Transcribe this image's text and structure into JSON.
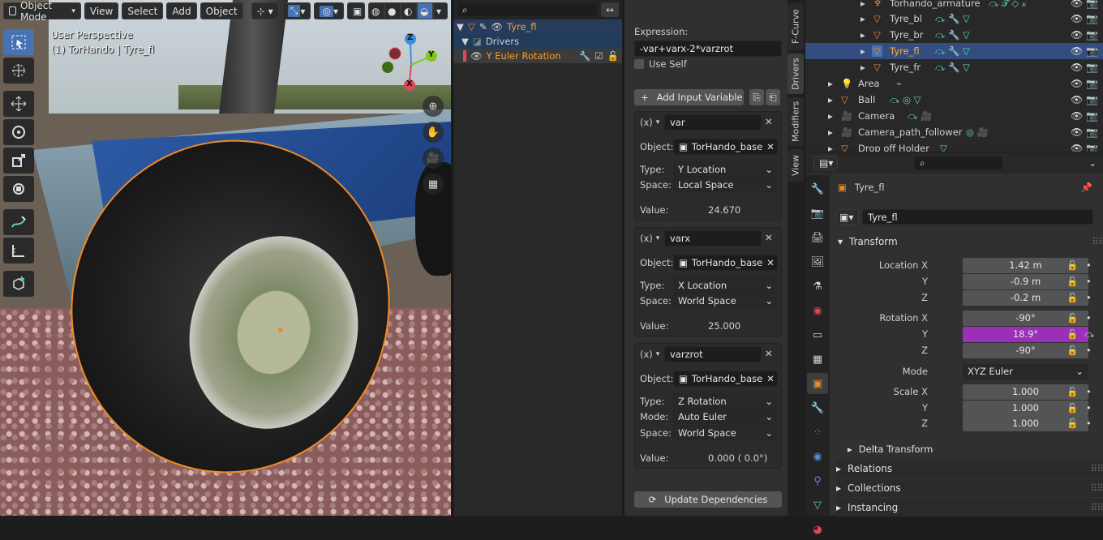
{
  "viewport": {
    "mode_label": "Object Mode",
    "menu": [
      "View",
      "Select",
      "Add",
      "Object"
    ],
    "perspective": "User Perspective",
    "object_info": "(1) TorHando | Tyre_fl",
    "gizmo_axes": [
      "Z",
      "Y",
      "X"
    ]
  },
  "drivers_list": {
    "object": "Tyre_fl",
    "group": "Drivers",
    "channel": "Y Euler Rotation"
  },
  "driver": {
    "expression_label": "Expression:",
    "expression": "-var+varx-2*varzrot",
    "use_self": "Use Self",
    "add_var": "Add Input Variable",
    "variables": [
      {
        "name": "var",
        "object_label": "Object:",
        "object": "TorHando_base",
        "type_label": "Type:",
        "type": "Y Location",
        "space_label": "Space:",
        "space": "Local Space",
        "value_label": "Value:",
        "value": "24.670"
      },
      {
        "name": "varx",
        "object_label": "Object:",
        "object": "TorHando_base",
        "type_label": "Type:",
        "type": "X Location",
        "space_label": "Space:",
        "space": "World Space",
        "value_label": "Value:",
        "value": "25.000"
      },
      {
        "name": "varzrot",
        "object_label": "Object:",
        "object": "TorHando_base",
        "type_label": "Type:",
        "type": "Z Rotation",
        "mode_label": "Mode:",
        "mode": "Auto Euler",
        "space_label": "Space:",
        "space": "World Space",
        "value_label": "Value:",
        "value": "0.000 ( 0.0°)"
      }
    ],
    "update_deps": "Update Dependencies"
  },
  "side_tabs": [
    "F-Curve",
    "Drivers",
    "Modifiers",
    "View"
  ],
  "outliner": {
    "rows": [
      "Torhando_armature",
      "Tyre_bl",
      "Tyre_br",
      "Tyre_fl",
      "Tyre_fr",
      "Area",
      "Ball",
      "Camera",
      "Camera_path_follower",
      "Drop off Holder"
    ]
  },
  "properties": {
    "object_name": "Tyre_fl",
    "data_name": "Tyre_fl",
    "transform_label": "Transform",
    "location": {
      "x_label": "Location X",
      "y_label": "Y",
      "z_label": "Z",
      "x": "1.42 m",
      "y": "-0.9 m",
      "z": "-0.2 m"
    },
    "rotation": {
      "x_label": "Rotation X",
      "y_label": "Y",
      "z_label": "Z",
      "x": "-90°",
      "y": "18.9°",
      "z": "-90°"
    },
    "mode_label": "Mode",
    "mode": "XYZ Euler",
    "scale": {
      "x_label": "Scale X",
      "y_label": "Y",
      "z_label": "Z",
      "x": "1.000",
      "y": "1.000",
      "z": "1.000"
    },
    "delta": "Delta Transform",
    "relations": "Relations",
    "collections": "Collections",
    "instancing": "Instancing"
  },
  "colors": {
    "accent": "#4772b3",
    "selected": "#334d80",
    "driven": "#9a30b8",
    "orange": "#f08a24",
    "green": "#5fd6a6"
  }
}
